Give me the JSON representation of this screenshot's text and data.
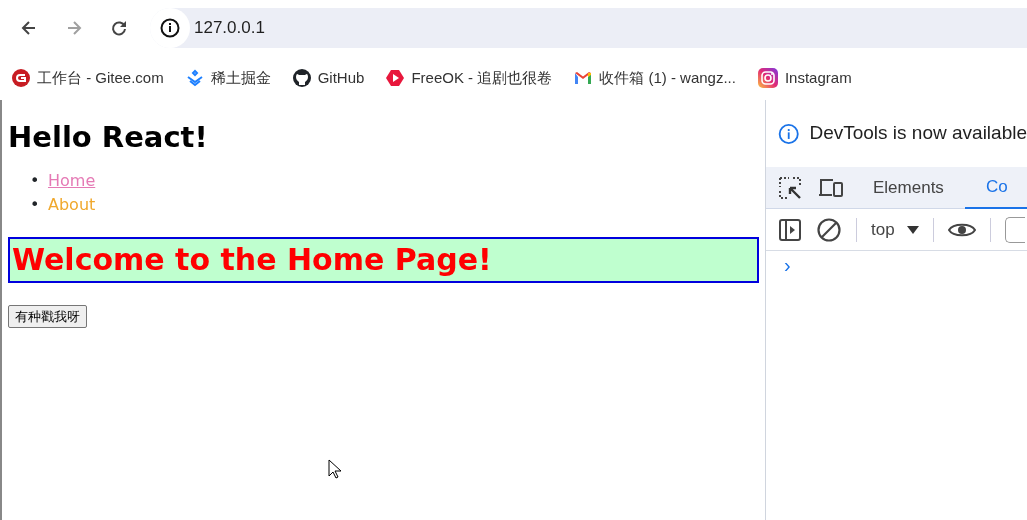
{
  "browser": {
    "nav_buttons": [
      {
        "kind": "back",
        "disabled": false
      },
      {
        "kind": "forward",
        "disabled": true
      },
      {
        "kind": "reload",
        "disabled": false
      }
    ],
    "address": "127.0.0.1",
    "bookmarks": [
      {
        "kind": "gitee",
        "label": "工作台 - Gitee.com"
      },
      {
        "kind": "juejin",
        "label": "稀土掘金"
      },
      {
        "kind": "github",
        "label": "GitHub"
      },
      {
        "kind": "freeok",
        "label": "FreeOK - 追剧也很卷"
      },
      {
        "kind": "gmail",
        "label": "收件箱 (1) - wangz..."
      },
      {
        "kind": "instagram",
        "label": "Instagram"
      }
    ]
  },
  "page": {
    "heading": "Hello React!",
    "links": [
      {
        "bullet": "•",
        "label": "Home",
        "selected": true
      },
      {
        "bullet": "•",
        "label": "About",
        "selected": false
      }
    ],
    "banner": "Welcome to the Home Page!",
    "button": "有种戳我呀"
  },
  "devtools": {
    "notice": "DevTools is now available",
    "tabs": [
      {
        "label": "Elements",
        "selected": false
      },
      {
        "label": "Co",
        "selected": true
      }
    ],
    "context": "top",
    "prompt": "›"
  }
}
